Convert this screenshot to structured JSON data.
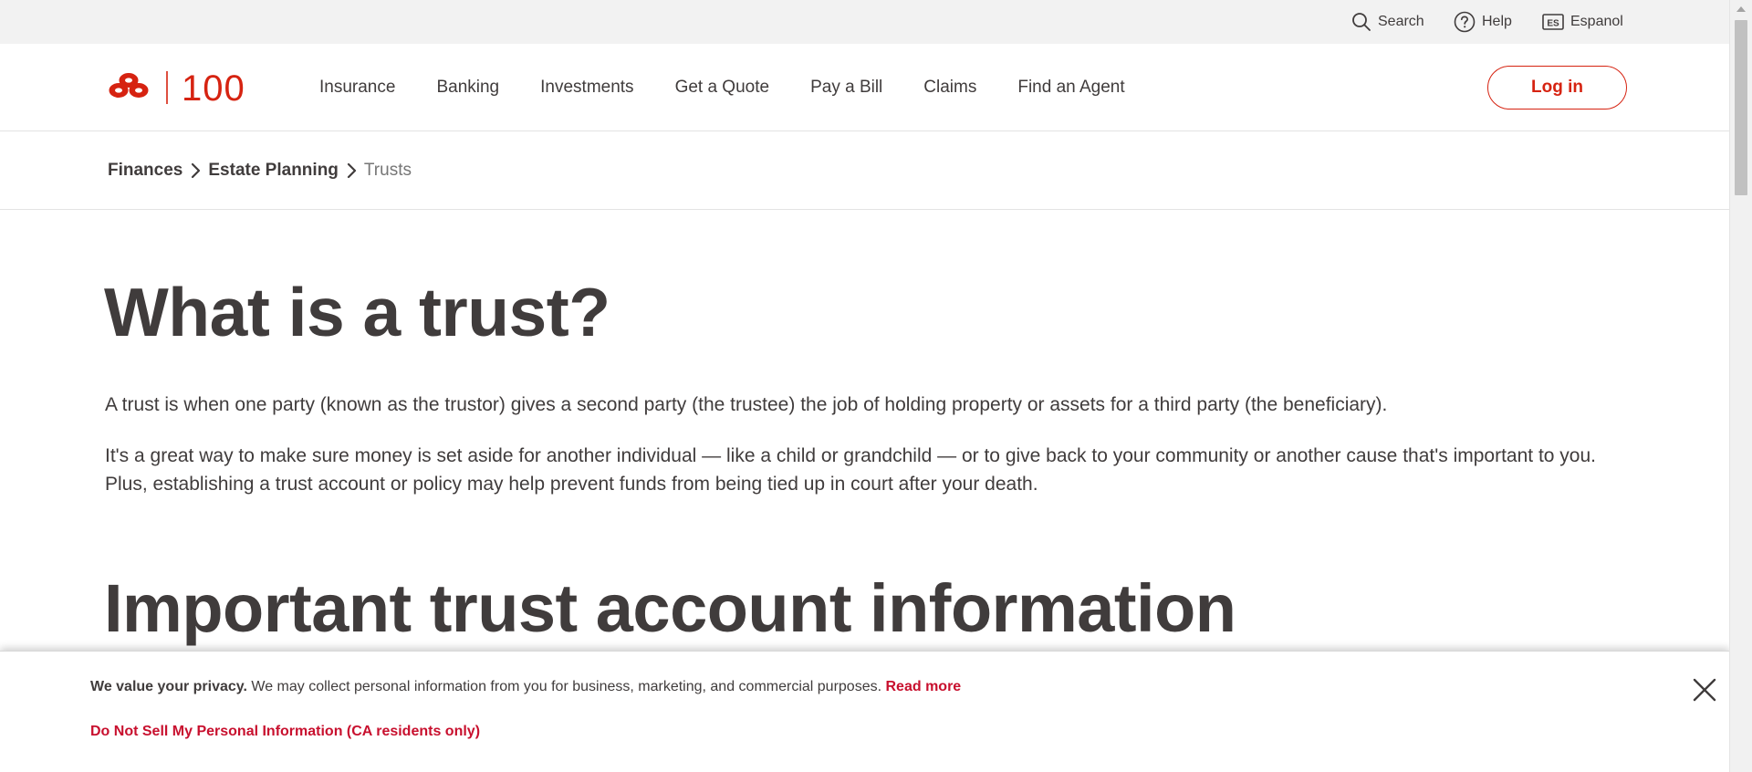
{
  "utility": {
    "search_label": "Search",
    "help_label": "Help",
    "espanol_label": "Espanol",
    "espanol_badge": "ES"
  },
  "header": {
    "logo_text": "100",
    "nav": [
      {
        "label": "Insurance"
      },
      {
        "label": "Banking"
      },
      {
        "label": "Investments"
      },
      {
        "label": "Get a Quote"
      },
      {
        "label": "Pay a Bill"
      },
      {
        "label": "Claims"
      },
      {
        "label": "Find an Agent"
      }
    ],
    "login_label": "Log in"
  },
  "breadcrumb": {
    "items": [
      {
        "label": "Finances"
      },
      {
        "label": "Estate Planning"
      }
    ],
    "current": "Trusts"
  },
  "content": {
    "heading": "What is a trust?",
    "paragraph1": "A trust is when one party (known as the trustor) gives a second party (the trustee) the job of holding property or assets for a third party (the beneficiary).",
    "paragraph2": "It's a great way to make sure money is set aside for another individual — like a child or grandchild — or to give back to your community or another cause that's important to you. Plus, establishing a trust account or policy may help prevent funds from being tied up in court after your death.",
    "heading2": "Important trust account information"
  },
  "privacy": {
    "title": "We value your privacy.",
    "body": " We may collect personal information from you for business, marketing, and commercial purposes. ",
    "read_more": "Read more",
    "do_not_sell": "Do Not Sell My Personal Information (CA residents only)"
  },
  "colors": {
    "brand_red": "#d62311",
    "text": "#403c3c",
    "utility_bg": "#f2f2f2"
  },
  "icons": {
    "search": "search-icon",
    "help": "help-icon",
    "espanol": "espanol-icon",
    "chevron": "chevron-right-icon",
    "close": "close-icon",
    "logo": "logo-icon"
  }
}
